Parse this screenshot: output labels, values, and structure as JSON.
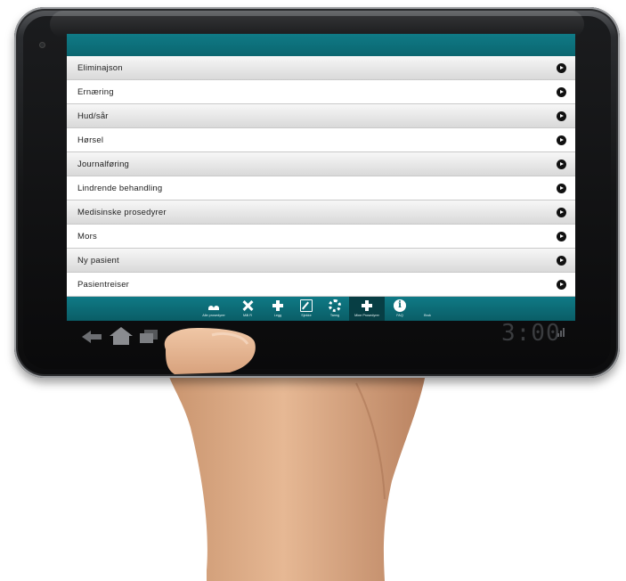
{
  "list": {
    "items": [
      "Eliminajson",
      "Ernæring",
      "Hud/sår",
      "Hørsel",
      "Journalføring",
      "Lindrende behandling",
      "Medisinske prosedyrer",
      "Mors",
      "Ny pasient",
      "Pasientreiser"
    ]
  },
  "tabbar": {
    "items": [
      {
        "label": "Alle prosedyrer",
        "icon": "users-icon"
      },
      {
        "label": "Mål R",
        "icon": "close-icon"
      },
      {
        "label": "Legg",
        "icon": "plus-icon"
      },
      {
        "label": "Sjekke",
        "icon": "edit-icon"
      },
      {
        "label": "Tanng",
        "icon": "gear-icon"
      },
      {
        "label": "Mine Prosedyrer",
        "icon": "plus-icon",
        "active": true
      },
      {
        "label": "FAQ",
        "icon": "info-icon"
      },
      {
        "label": "Bruk",
        "icon": ""
      }
    ]
  },
  "system_bar": {
    "clock": "3:00"
  },
  "colors": {
    "accent": "#0c6a74",
    "active_tab": "#073e44"
  }
}
